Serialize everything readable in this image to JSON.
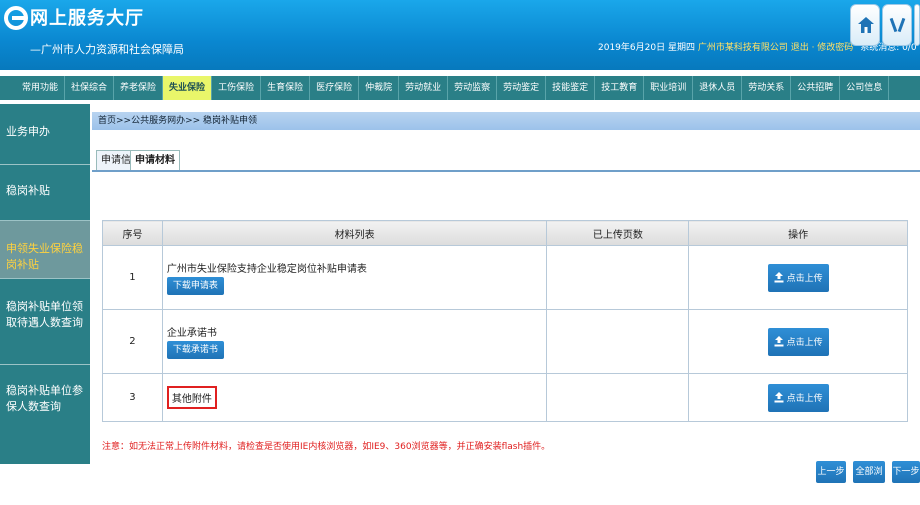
{
  "header": {
    "title": "网上服务大厅",
    "subtitle": "—广州市人力资源和社会保障局",
    "date": "2019年6月20日 星期四",
    "company": "广州市某科技有限公司",
    "status_links": "退出 · 修改密码",
    "system_msg": "系统消息: 0/0",
    "buttons": [
      "home-icon",
      "tools-icon",
      "close-icon"
    ]
  },
  "nav": {
    "items": [
      "常用功能",
      "社保综合",
      "养老保险",
      "失业保险",
      "工伤保险",
      "生育保险",
      "医疗保险",
      "仲裁院",
      "劳动就业",
      "劳动监察",
      "劳动鉴定",
      "技能鉴定",
      "技工教育",
      "职业培训",
      "退休人员",
      "劳动关系",
      "公共招聘",
      "公司信息"
    ],
    "active_index": 3
  },
  "sidebar": {
    "items": [
      {
        "label": "业务申办"
      },
      {
        "label": "稳岗补贴"
      },
      {
        "label": "申领失业保险稳岗补贴"
      },
      {
        "label": "稳岗补贴单位领取待遇人数查询"
      },
      {
        "label": "稳岗补贴单位参保人数查询"
      }
    ]
  },
  "main": {
    "breadcrumb": "首页>>公共服务网办>> 稳岗补贴申领",
    "tabs": [
      "申请信息",
      "申请材料"
    ],
    "table": {
      "headers": [
        "序号",
        "材料列表",
        "已上传页数",
        "操作"
      ],
      "rows": [
        {
          "num": "1",
          "name": "广州市失业保险支持企业稳定岗位补贴申请表",
          "download": "下载申请表",
          "pages": "",
          "action": "点击上传"
        },
        {
          "num": "2",
          "name": "企业承诺书",
          "download": "下载承诺书",
          "pages": "",
          "action": "点击上传"
        },
        {
          "num": "3",
          "name": "其他附件",
          "download": "",
          "pages": "",
          "action": "点击上传"
        }
      ]
    },
    "notice": "注意：如无法正常上传附件材料，请检查是否使用IE内核浏览器，如IE9、360浏览器等，并正确安装flash插件。",
    "buttons": {
      "prev": "上一步",
      "preview": "全部浏览",
      "next": "下一步"
    }
  },
  "colors": {
    "header": "#0a87d0",
    "nav": "#2a7f87",
    "active_nav": "#e9f66a",
    "button": "#1f73b6",
    "notice": "#e02020"
  }
}
